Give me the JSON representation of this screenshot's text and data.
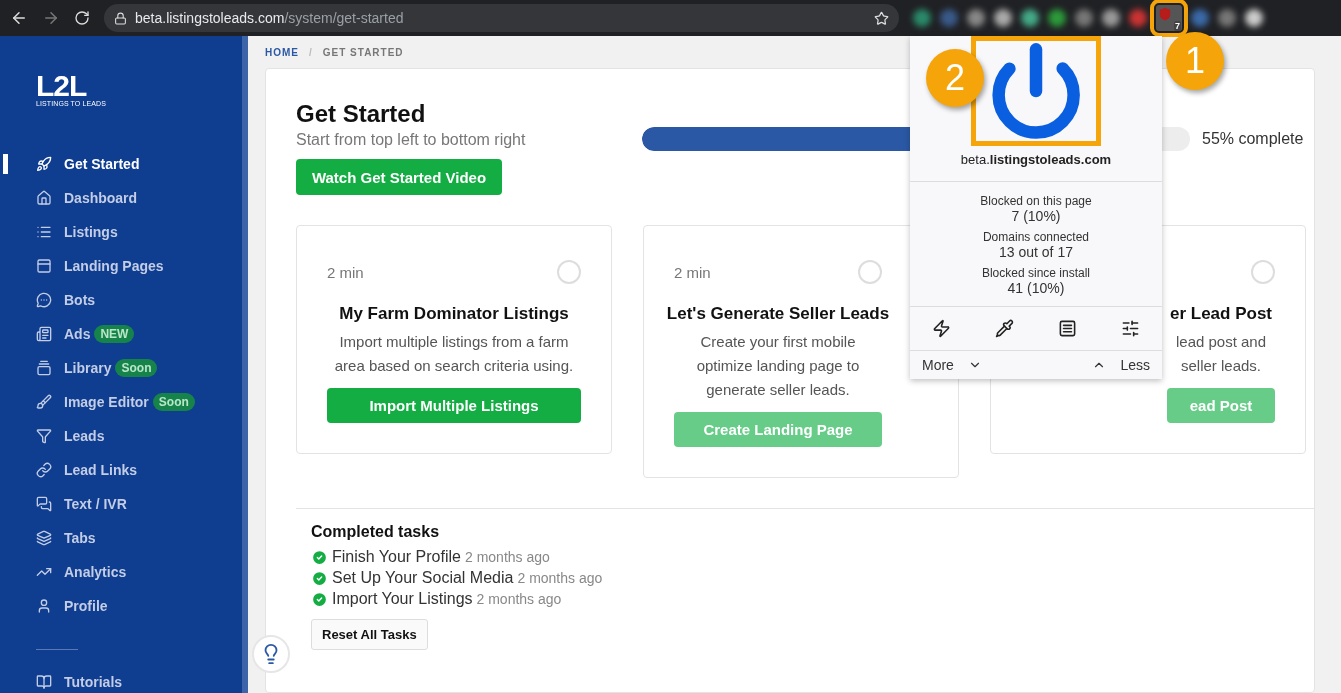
{
  "browser": {
    "url_domain": "beta.listingstoleads.com",
    "url_path": "/system/get-started",
    "extension_badge": "7"
  },
  "sidebar": {
    "logo": "L2L",
    "tagline": "LISTINGS TO LEADS",
    "items": [
      {
        "label": "Get Started",
        "selected": true
      },
      {
        "label": "Dashboard",
        "selected": false
      },
      {
        "label": "Listings",
        "selected": false
      },
      {
        "label": "Landing Pages",
        "selected": false
      },
      {
        "label": "Bots",
        "selected": false
      },
      {
        "label": "Ads",
        "selected": false,
        "badge": "NEW"
      },
      {
        "label": "Library",
        "selected": false,
        "badge": "Soon"
      },
      {
        "label": "Image Editor",
        "selected": false,
        "badge": "Soon"
      },
      {
        "label": "Leads",
        "selected": false
      },
      {
        "label": "Lead Links",
        "selected": false
      },
      {
        "label": "Text / IVR",
        "selected": false
      },
      {
        "label": "Tabs",
        "selected": false
      },
      {
        "label": "Analytics",
        "selected": false
      },
      {
        "label": "Profile",
        "selected": false
      }
    ],
    "footer_item": "Tutorials"
  },
  "breadcrumb_separator": "/",
  "breadcrumb": [
    {
      "label": "HOME",
      "current": false
    },
    {
      "label": "GET STARTED",
      "current": true
    }
  ],
  "page": {
    "title": "Get Started",
    "subtitle": "Start from top left to bottom right",
    "video_button": "Watch Get Started Video",
    "progress": {
      "level": 0.55,
      "reading": "55% complete"
    }
  },
  "cards": [
    {
      "duration": "2 min",
      "checked": false,
      "title": "My Farm Dominator Listings",
      "description": "Import multiple listings from a farm area based on search criteria using.",
      "button": "Import Multiple Listings",
      "disabled": false
    },
    {
      "duration": "2 min",
      "checked": false,
      "title": "Let's Generate Seller Leads",
      "description": "Create your first mobile optimize landing page to generate seller leads.",
      "button": "Create Landing Page",
      "disabled": true
    },
    {
      "checked": false,
      "title": "er Lead Post",
      "description": "lead post and seller leads.",
      "button": "ead Post",
      "disabled": true
    }
  ],
  "completed": {
    "title": "Completed tasks",
    "tasks": [
      {
        "label": "Finish Your Profile",
        "time": "2 months ago"
      },
      {
        "label": "Set Up Your Social Media",
        "time": "2 months ago"
      },
      {
        "label": "Import Your Listings",
        "time": "2 months ago"
      }
    ],
    "reset_button": "Reset All Tasks"
  },
  "popup": {
    "domain": "beta.**listingstoleads.com**",
    "stats": [
      {
        "label": "Blocked on this page",
        "value": "7 (10%)"
      },
      {
        "label": "Domains connected",
        "value": "13 out of 17"
      },
      {
        "label": "Blocked since install",
        "value": "41 (10%)"
      }
    ],
    "more": "More",
    "less": "Less"
  },
  "callouts": [
    "1",
    "2"
  ]
}
